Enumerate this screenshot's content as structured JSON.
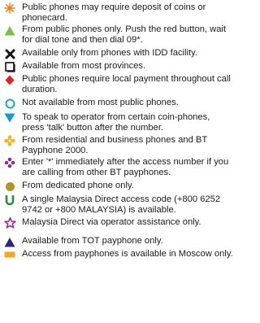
{
  "legend": {
    "items": [
      {
        "icon": "orange-asterisk-icon",
        "color": "#f07d1a",
        "text": "Public phones may require deposit of coins or phonecard."
      },
      {
        "icon": "green-triangle-icon",
        "color": "#7cc242",
        "text": "From public phones only. Push the red button, wait for dial tone and then dial 09*."
      },
      {
        "icon": "black-cross-icon",
        "color": "#111111",
        "text": "Available only from phones with IDD facility."
      },
      {
        "icon": "outlined-square-icon",
        "color": "#111111",
        "text": "Available from most provinces."
      },
      {
        "icon": "red-diamond-icon",
        "color": "#e2231a",
        "text": "Public phones require local payment throughout call duration."
      },
      {
        "icon": "teal-ring-icon",
        "color": "#19a9b6",
        "text": "Not available from most public phones."
      },
      {
        "icon": "blue-down-triangle-icon",
        "color": "#1597d4",
        "text": "To speak to operator from certain coin-phones, press 'talk' button after the number."
      },
      {
        "icon": "yellow-flower-icon",
        "color": "#f5b21c",
        "text": "From residential and business phones and BT Payphone 2000."
      },
      {
        "icon": "purple-dots-icon",
        "color": "#8b2f8f",
        "text": "Enter '*' immediately after the access number if you are calling from other BT payphones."
      },
      {
        "icon": "olive-circle-icon",
        "color": "#b09528",
        "text": "From dedicated phone only."
      },
      {
        "icon": "green-u-icon",
        "color": "#2e8b3a",
        "text": "A single Malaysia Direct access code (+800 6252 9742 or +800 MALAYSIA) is available."
      },
      {
        "icon": "purple-star-icon",
        "color": "#a0208f",
        "text": "Malaysia Direct via operator assistance only."
      },
      {
        "icon": "navy-triangle-icon",
        "color": "#2b2680",
        "text": "Available from TOT payphone only."
      },
      {
        "icon": "orange-bar-icon",
        "color": "#f5a623",
        "text": "Access from payphones is available in Moscow only."
      }
    ]
  }
}
